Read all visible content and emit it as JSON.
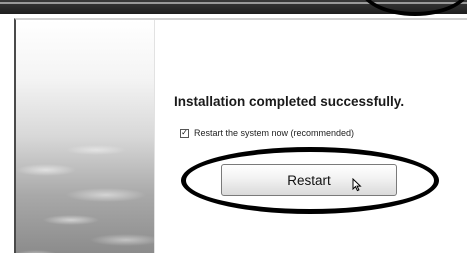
{
  "installer": {
    "title": "Installation completed successfully.",
    "checkbox": {
      "label": "Restart the system now (recommended)",
      "checked": true,
      "check_glyph": "✓"
    },
    "restart_button_label": "Restart"
  },
  "icons": {
    "cursor": "mouse-pointer-icon",
    "decoration": "water-texture-image"
  },
  "colors": {
    "annotation": "#000000",
    "button_border": "#7a7a7a",
    "text": "#1a1a1a"
  }
}
